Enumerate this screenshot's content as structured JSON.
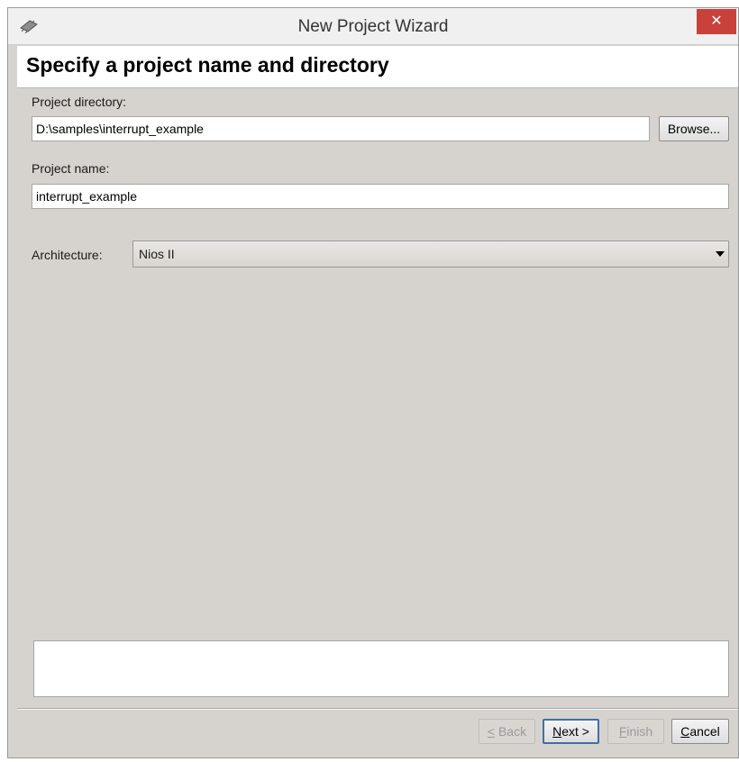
{
  "window": {
    "title": "New Project Wizard",
    "close_glyph": "✕",
    "app_icon": "chip-icon"
  },
  "header": {
    "title": "Specify a project name and directory"
  },
  "form": {
    "directory_label": "Project directory:",
    "directory_value": "D:\\samples\\interrupt_example",
    "browse_label": "Browse...",
    "name_label": "Project name:",
    "name_value": "interrupt_example",
    "architecture_label": "Architecture:",
    "architecture_value": "Nios II"
  },
  "message": {
    "text": ""
  },
  "footer": {
    "back": {
      "mnemonic": "<",
      "rest": " Back",
      "enabled": false
    },
    "next": {
      "mnemonic": "N",
      "rest": "ext >",
      "enabled": true
    },
    "finish": {
      "mnemonic": "F",
      "rest": "inish",
      "enabled": false
    },
    "cancel": {
      "mnemonic": "C",
      "rest": "ancel",
      "enabled": true
    }
  },
  "colors": {
    "close_button": "#c8423b",
    "dialog_background": "#d6d3ce",
    "default_button_border": "#3c6fb0"
  }
}
